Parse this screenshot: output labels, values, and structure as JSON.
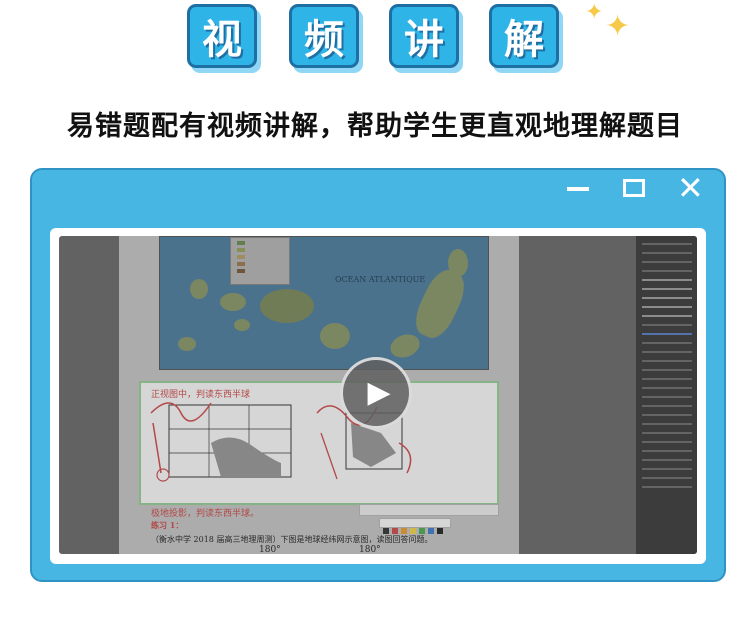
{
  "title_chars": [
    "视",
    "频",
    "讲",
    "解"
  ],
  "subtitle": "易错题配有视频讲解，帮助学生更直观地理解题目",
  "window": {
    "minimize_icon": "minimize-icon",
    "maximize_icon": "maximize-icon",
    "close_icon": "close-icon",
    "close_glyph": "✕"
  },
  "video": {
    "map_label": "OCEAN ATLANTIQUE",
    "sheet_note_1": "正视图中，判读东西半球",
    "sheet_note_2": "极地投影，判读东西半球。",
    "exercise_label": "练习 1：",
    "question_text": "（衡水中学 2018 届高三地理周测）下图是地球经纬网示意图，读图回答问题。",
    "degree_1": "180°",
    "degree_2": "180°",
    "play_glyph": "▶"
  },
  "colors": {
    "tile_blue": "#2fb4e8",
    "window_blue": "#48b6e3",
    "sparkle_yellow": "#f7c948"
  }
}
